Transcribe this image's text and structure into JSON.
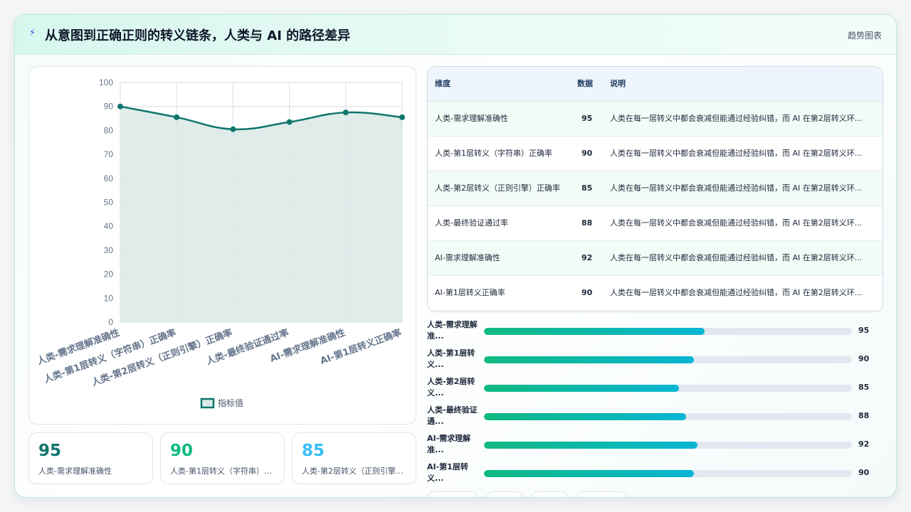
{
  "header": {
    "icon": "lightning-icon",
    "title": "从意图到正确正则的转义链条，人类与 AI 的路径差异",
    "right_label": "趋势图表"
  },
  "chart_data": {
    "type": "area",
    "categories": [
      "人类-需求理解准确性",
      "人类-第1层转义（字符串）正确率",
      "人类-第2层转义（正则引擎）正确率",
      "人类-最终验证通过率",
      "AI-需求理解准确性",
      "AI-第1层转义正确率"
    ],
    "series": [
      {
        "name": "指标值",
        "values": [
          90,
          85.5,
          80.5,
          83.5,
          87.5,
          85.5
        ]
      }
    ],
    "ylim": [
      0,
      100
    ],
    "yticks": [
      0,
      10,
      20,
      30,
      40,
      50,
      60,
      70,
      80,
      90,
      100
    ],
    "grid": true,
    "legend": "bottom",
    "colors": {
      "line": "#0f766e",
      "fill": "#dbeae8",
      "grid": "#d7dee6"
    }
  },
  "stats": [
    {
      "value": "95",
      "label": "人类-需求理解准确性",
      "color": "#0f766e"
    },
    {
      "value": "90",
      "label": "人类-第1层转义（字符串）正确率",
      "color": "#10b981"
    },
    {
      "value": "85",
      "label": "人类-第2层转义（正则引擎）正确率",
      "color": "#38bdf8"
    }
  ],
  "table": {
    "headers": [
      "维度",
      "数据",
      "说明"
    ],
    "rows": [
      {
        "dim": "人类-需求理解准确性",
        "value": "95",
        "note": "人类在每一层转义中都会衰减但能通过经验纠错，而 AI 在第2层转义环..."
      },
      {
        "dim": "人类-第1层转义（字符串）正确率",
        "value": "90",
        "note": "人类在每一层转义中都会衰减但能通过经验纠错，而 AI 在第2层转义环..."
      },
      {
        "dim": "人类-第2层转义（正则引擎）正确率",
        "value": "85",
        "note": "人类在每一层转义中都会衰减但能通过经验纠错，而 AI 在第2层转义环..."
      },
      {
        "dim": "人类-最终验证通过率",
        "value": "88",
        "note": "人类在每一层转义中都会衰减但能通过经验纠错，而 AI 在第2层转义环..."
      },
      {
        "dim": "AI-需求理解准确性",
        "value": "92",
        "note": "人类在每一层转义中都会衰减但能通过经验纠错，而 AI 在第2层转义环..."
      },
      {
        "dim": "AI-第1层转义正确率",
        "value": "90",
        "note": "人类在每一层转义中都会衰减但能通过经验纠错，而 AI 在第2层转义环..."
      }
    ]
  },
  "bars": [
    {
      "label": "人类-需求理解准...",
      "value": 95,
      "fill": 0.6
    },
    {
      "label": "人类-第1层转义...",
      "value": 90,
      "fill": 0.57
    },
    {
      "label": "人类-第2层转义...",
      "value": 85,
      "fill": 0.53
    },
    {
      "label": "人类-最终验证通...",
      "value": 88,
      "fill": 0.55
    },
    {
      "label": "AI-需求理解准...",
      "value": 92,
      "fill": 0.58
    },
    {
      "label": "AI-第1层转义...",
      "value": 90,
      "fill": 0.57
    }
  ]
}
